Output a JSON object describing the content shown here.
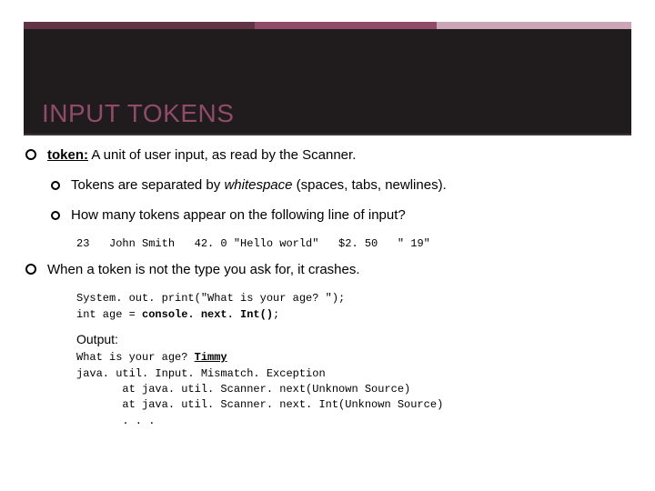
{
  "title": "INPUT TOKENS",
  "b1_label": "token:",
  "b1_rest": " A unit of user input, as read by the Scanner.",
  "b2_a": "Tokens are separated by ",
  "b2_ital": "whitespace",
  "b2_b": " (spaces, tabs, newlines).",
  "b3": "How many tokens appear on the following line of input?",
  "code1": "23   John Smith   42. 0 \"Hello world\"   $2. 50   \" 19\"",
  "b4": "When a token is not the type you ask for, it crashes.",
  "code2": "System. out. print(\"What is your age? \");\nint age = console. next. Int();",
  "output_label": "Output:",
  "output_a": "What is your age? ",
  "output_user": "Timmy",
  "output_rest": "java. util. Input. Mismatch. Exception\n       at java. util. Scanner. next(Unknown Source)\n       at java. util. Scanner. next. Int(Unknown Source)\n       . . ."
}
